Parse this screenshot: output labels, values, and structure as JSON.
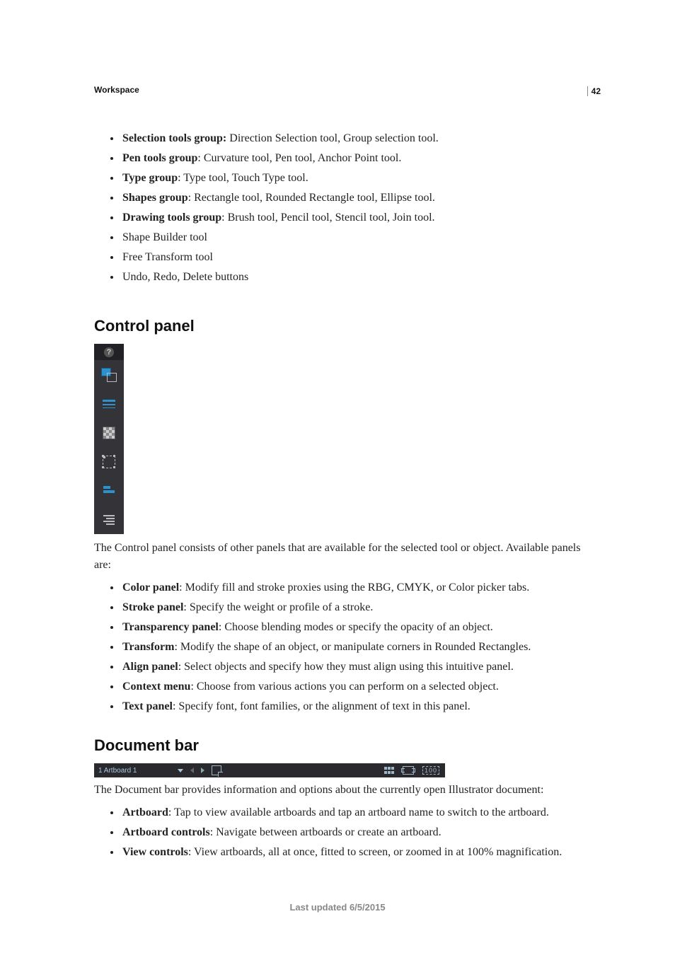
{
  "page_number": "42",
  "chapter": "Workspace",
  "toolbar_list": [
    {
      "label": "Selection tools group:",
      "desc": " Direction Selection tool, Group selection tool."
    },
    {
      "label": "Pen tools group",
      "desc": ": Curvature tool, Pen tool, Anchor Point tool."
    },
    {
      "label": "Type group",
      "desc": ": Type tool, Touch Type tool."
    },
    {
      "label": "Shapes group",
      "desc": ": Rectangle tool, Rounded Rectangle tool, Ellipse tool."
    },
    {
      "label": "Drawing tools group",
      "desc": ": Brush tool, Pencil tool, Stencil tool, Join tool."
    },
    {
      "plain": "Shape Builder tool"
    },
    {
      "plain": "Free Transform tool"
    },
    {
      "plain": "Undo, Redo, Delete buttons"
    }
  ],
  "heading_control_panel": "Control panel",
  "control_panel_intro": "The Control panel consists of other panels that are available for the selected tool or object. Available panels are:",
  "control_panel_list": [
    {
      "label": "Color panel",
      "desc": ": Modify fill and stroke proxies using the RBG, CMYK, or Color picker tabs."
    },
    {
      "label": "Stroke panel",
      "desc": ": Specify the weight or profile of a stroke."
    },
    {
      "label": "Transparency panel",
      "desc": ": Choose blending modes or specify the opacity of an object."
    },
    {
      "label": "Transform",
      "desc": ": Modify the shape of an object, or manipulate corners in Rounded Rectangles."
    },
    {
      "label": "Align panel",
      "desc": ": Select objects and specify how they must align using this intuitive panel."
    },
    {
      "label": "Context menu",
      "desc": ": Choose from various actions you can perform on a selected object."
    },
    {
      "label": "Text panel",
      "desc": ": Specify font, font families, or the alignment of text in this panel."
    }
  ],
  "heading_document_bar": "Document bar",
  "docbar": {
    "artboard_name": "1 Artboard 1"
  },
  "document_bar_intro": "The Document bar provides information and options about the currently open Illustrator document:",
  "document_bar_list": [
    {
      "label": "Artboard",
      "desc": ": Tap to view available artboards and tap an artboard name to switch to the artboard."
    },
    {
      "label": "Artboard controls",
      "desc": ": Navigate between artboards or create an artboard."
    },
    {
      "label": "View controls",
      "desc": ": View artboards, all at once, fitted to screen, or zoomed in at 100% magnification."
    }
  ],
  "footer": "Last updated 6/5/2015"
}
